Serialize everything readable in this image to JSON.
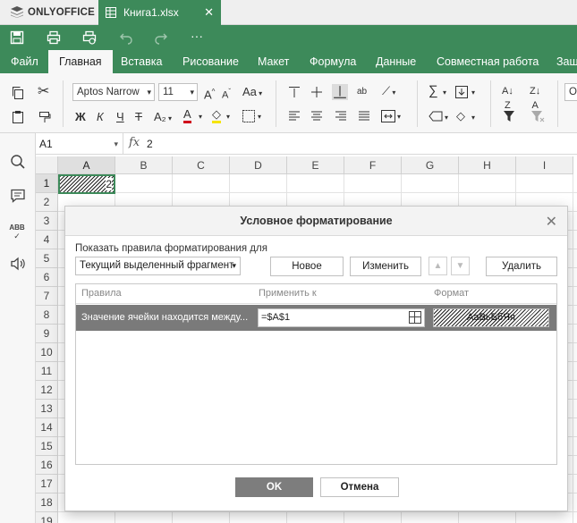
{
  "app": {
    "logo": "ONLYOFFICE",
    "doc_tab": "Книга1.xlsx"
  },
  "colors": {
    "brand_green": "#3d8a5a",
    "selected_row": "#7a7a7a",
    "ok_button": "#7d7d7d"
  },
  "menu": {
    "items": [
      "Файл",
      "Главная",
      "Вставка",
      "Рисование",
      "Макет",
      "Формула",
      "Данные",
      "Совместная работа",
      "Защ"
    ],
    "active": "Главная"
  },
  "toolbar": {
    "font_name": "Aptos Narrow",
    "font_size": "11",
    "bold": "Ж",
    "italic": "К",
    "underline": "Ч",
    "strike": "Т",
    "subscript": "A₂",
    "font_color": "A",
    "case_label": "Aa",
    "grow": "A",
    "shrink": "A",
    "wrap_label": "ab",
    "sum": "∑"
  },
  "formula_bar": {
    "cell_ref": "A1",
    "fx": "fx",
    "value": "2"
  },
  "grid": {
    "columns": [
      "A",
      "B",
      "C",
      "D",
      "E",
      "F",
      "G",
      "H",
      "I"
    ],
    "rows": [
      "1",
      "2",
      "3",
      "4",
      "5",
      "6",
      "7",
      "8",
      "9",
      "10",
      "11",
      "12",
      "13",
      "14",
      "15",
      "16",
      "17",
      "18",
      "19"
    ],
    "a1_value": "2"
  },
  "dialog": {
    "title": "Условное форматирование",
    "show_rules_label": "Показать правила форматирования для",
    "scope_value": "Текущий выделенный фрагмент",
    "new_button": "Новое",
    "edit_button": "Изменить",
    "delete_button": "Удалить",
    "columns": {
      "rules": "Правила",
      "apply_to": "Применить к",
      "format": "Формат"
    },
    "rules": [
      {
        "rule": "Значение ячейки находится между...",
        "range": "=$A$1",
        "format_preview": "АаВьБбЯя"
      }
    ],
    "ok_button": "OK",
    "cancel_button": "Отмена"
  }
}
